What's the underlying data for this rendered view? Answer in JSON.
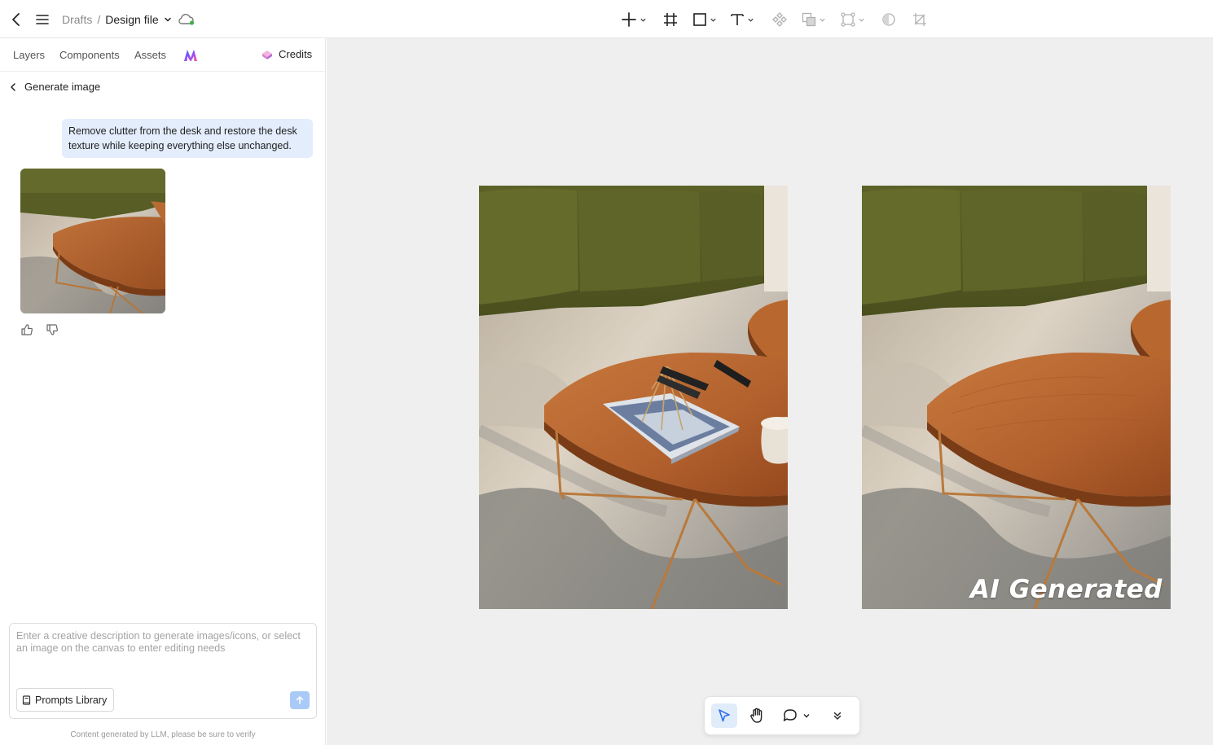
{
  "topbar": {
    "breadcrumb_parent": "Drafts",
    "breadcrumb_separator": "/",
    "file_name": "Design file",
    "icons": [
      "back-icon",
      "menu-icon",
      "cloud-sync-icon",
      "plus-icon",
      "frame-icon",
      "rectangle-icon",
      "text-icon",
      "component-icon",
      "boolean-icon",
      "instance-icon",
      "circle-icon",
      "crop-icon"
    ]
  },
  "panel": {
    "tabs": [
      "Layers",
      "Components",
      "Assets"
    ],
    "credits_label": "Credits",
    "header_title": "Generate image",
    "prompt_message": "Remove clutter from the desk and restore the desk texture while keeping everything else unchanged.",
    "composer_placeholder": "Enter a creative description to generate images/icons, or select an image on the canvas to enter editing needs",
    "prompts_library_label": "Prompts Library",
    "footnote": "Content generated by LLM, please be sure to verify"
  },
  "canvas": {
    "ai_badge": "AI Generated"
  },
  "bottom_toolbar": {
    "active_tool": "select",
    "icons": [
      "select-cursor-icon",
      "hand-icon",
      "comment-icon",
      "chevron-down-icon",
      "double-chevron-down-icon"
    ]
  },
  "colors": {
    "accent": "#2f6fed",
    "user_bubble": "#e3edfc",
    "send_button": "#a9c9f7",
    "canvas_bg": "#efefef"
  }
}
